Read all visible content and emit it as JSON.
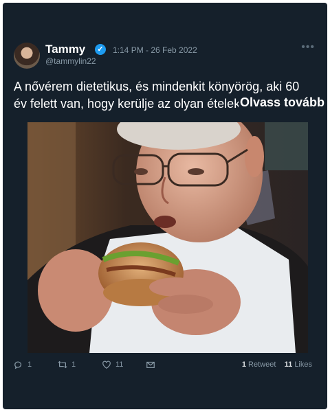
{
  "tweet": {
    "name": "Tammy",
    "handle": "@tammylin22",
    "timestamp": "1:14 PM - 26 Feb 2022",
    "verified_glyph": "✓",
    "more_glyph": "•••",
    "text_line1": "A nővérem dietetikus, és mindenkit könyörög, aki 60",
    "text_line2": "év felett van, hogy kerülje az olyan ételeket, mint a",
    "read_more": "Olvass tovább",
    "image_description": "elderly man eating a hamburger",
    "counts": {
      "replies": "1",
      "retweets": "1",
      "likes": "11"
    },
    "stats": {
      "retweets_number": "1",
      "retweets_label": "Retweet",
      "likes_number": "11",
      "likes_label": "Likes"
    }
  },
  "icons": [
    "reply-icon",
    "retweet-icon",
    "like-icon",
    "message-icon",
    "verified-icon",
    "more-icon"
  ],
  "colors": {
    "card_bg": "#15202b",
    "muted_text": "#8899a6",
    "verified": "#1d9bf0"
  }
}
